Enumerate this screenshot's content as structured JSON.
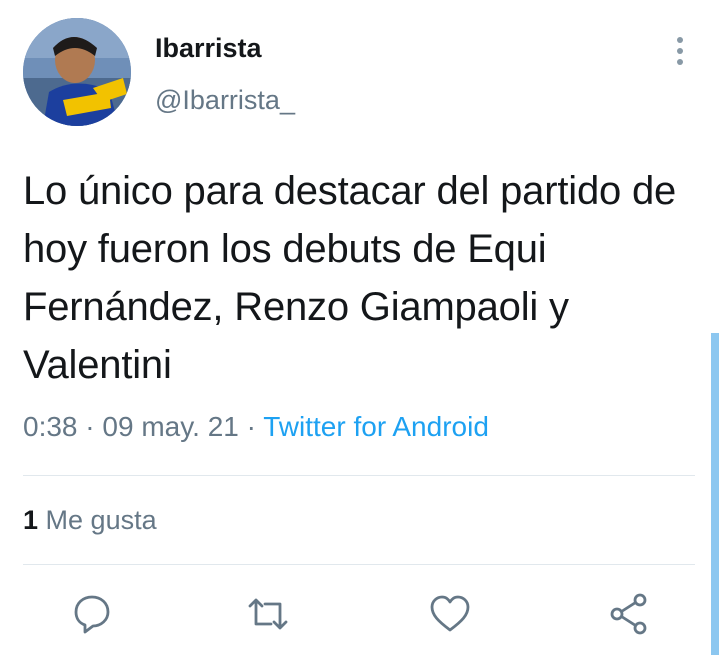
{
  "author": {
    "display_name": "Ibarrista",
    "handle": "@Ibarrista_",
    "avatar_icon": "avatar-photo"
  },
  "tweet": {
    "text": "Lo único para destacar del partido de hoy fueron los debuts de Equi Fernández, Renzo Giampaoli y Valentini",
    "time": "0:38",
    "date": "09 may. 21",
    "separator": " · ",
    "source": "Twitter for Android"
  },
  "stats": {
    "likes_count": "1",
    "likes_label": "Me gusta"
  },
  "actions": {
    "reply_icon": "reply-icon",
    "retweet_icon": "retweet-icon",
    "like_icon": "heart-icon",
    "share_icon": "share-icon"
  },
  "colors": {
    "text": "#14171a",
    "secondary": "#657786",
    "accent": "#1da1f2",
    "divider": "#e1e8ed"
  }
}
